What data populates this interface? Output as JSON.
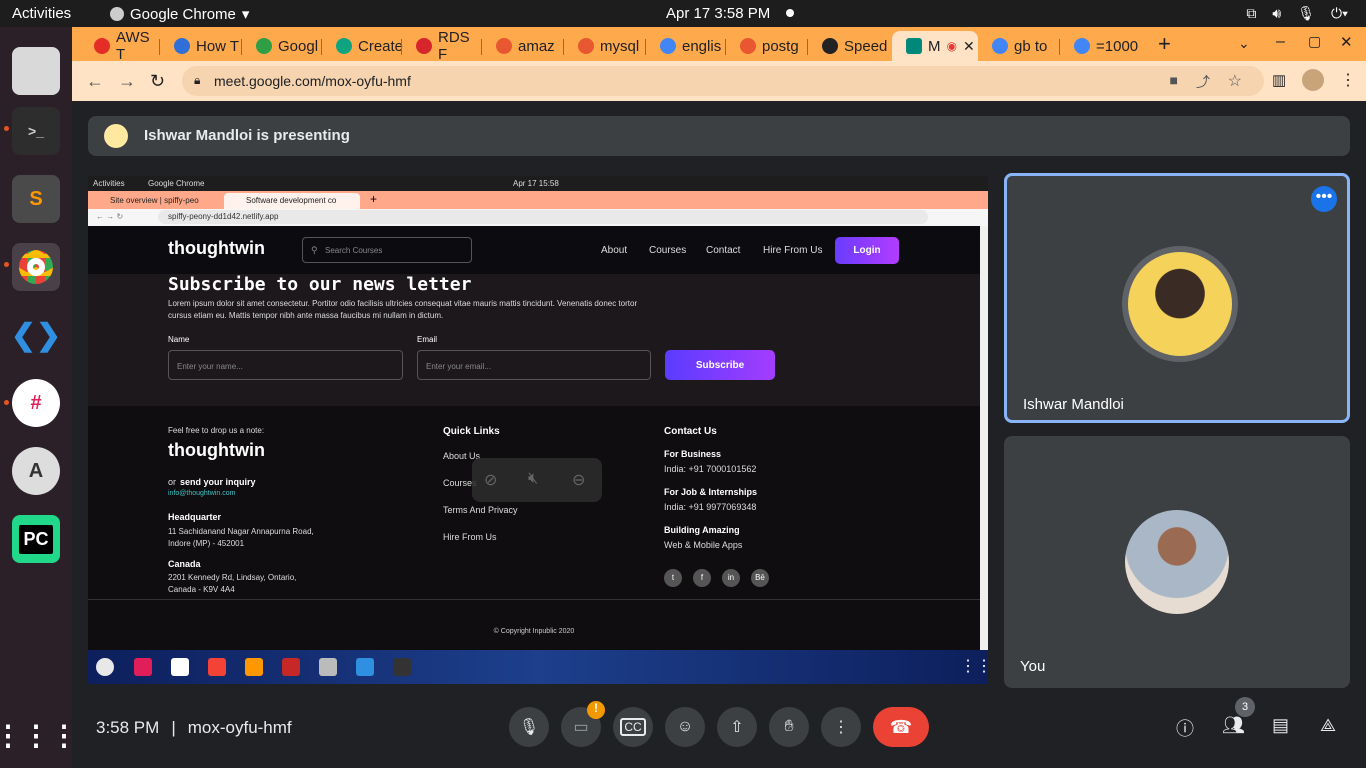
{
  "os_bar": {
    "activities": "Activities",
    "app": "Google Chrome",
    "datetime": "Apr 17  3:58 PM"
  },
  "tabs": [
    {
      "label": "AWS T",
      "color": "#e52d27"
    },
    {
      "label": "How T",
      "color": "#2f6fd6"
    },
    {
      "label": "Googl",
      "color": "#2f9e44"
    },
    {
      "label": "Create",
      "color": "#10a37f"
    },
    {
      "label": "RDS F",
      "color": "#d6262b"
    },
    {
      "label": "amaz",
      "color": "#e8572f"
    },
    {
      "label": "mysql",
      "color": "#e8572f"
    },
    {
      "label": "englis",
      "color": "#4285f4"
    },
    {
      "label": "postg",
      "color": "#e8572f"
    },
    {
      "label": "Speed",
      "color": "#222"
    },
    {
      "label": "M",
      "color": "#00897b"
    },
    {
      "label": "gb to",
      "color": "#4285f4"
    },
    {
      "label": "=1000",
      "color": "#4285f4"
    }
  ],
  "address": {
    "url": "meet.google.com/mox-oyfu-hmf"
  },
  "presenting": {
    "text": "Ishwar Mandloi is presenting"
  },
  "shared": {
    "os_activities": "Activities",
    "os_app": "Google Chrome",
    "os_date": "Apr 17  15:58",
    "tab1": "Site overview | spiffy-peo",
    "tab2": "Software development co",
    "url": "spiffy-peony-dd1d42.netlify.app",
    "logo": "thoughtwin",
    "search_placeholder": "Search Courses",
    "nav": [
      "About",
      "Courses",
      "Contact",
      "Hire From Us"
    ],
    "login": "Login",
    "news_title": "Subscribe to our news letter",
    "news_text": "Lorem ipsum dolor sit amet consectetur. Portitor odio facilisis ultricies consequat vitae mauris mattis tincidunt. Venenatis donec tortor cursus etiam eu. Mattis tempor nibh ante massa faucibus mi nullam in dictum.",
    "name_label": "Name",
    "name_placeholder": "Enter your name...",
    "email_label": "Email",
    "email_placeholder": "Enter your email...",
    "subscribe": "Subscribe",
    "footer": {
      "note": "Feel free to drop us a note:",
      "logo": "thoughtwin",
      "or": "or",
      "inquiry": "send your inquiry",
      "email": "info@thoughtwin.com",
      "hq_title": "Headquarter",
      "hq_addr1": "11 Sachidanand Nagar Annapurna Road,",
      "hq_addr2": "Indore (MP) - 452001",
      "ca_title": "Canada",
      "ca_addr1": "2201 Kennedy Rd, Lindsay, Ontario,",
      "ca_addr2": "Canada - K9V 4A4",
      "quick_title": "Quick Links",
      "quick": [
        "About Us",
        "Courses",
        "Terms And Privacy",
        "Hire From Us"
      ],
      "contact_title": "Contact Us",
      "business_title": "For Business",
      "business": "India: +91 7000101562",
      "job_title": "For Job & Internships",
      "job": "India: +91 9977069348",
      "build_title": "Building Amazing",
      "build": "Web & Mobile Apps",
      "social": [
        "t",
        "f",
        "in",
        "Bē"
      ],
      "copyright": "© Copyright Inpublic 2020"
    }
  },
  "participants": [
    {
      "name": "Ishwar Mandloi",
      "color": "#f5d35a"
    },
    {
      "name": "You",
      "color": "#d9c8b4"
    }
  ],
  "controls": {
    "time": "3:58 PM",
    "meeting_code": "mox-oyfu-hmf",
    "people_count": "3"
  }
}
